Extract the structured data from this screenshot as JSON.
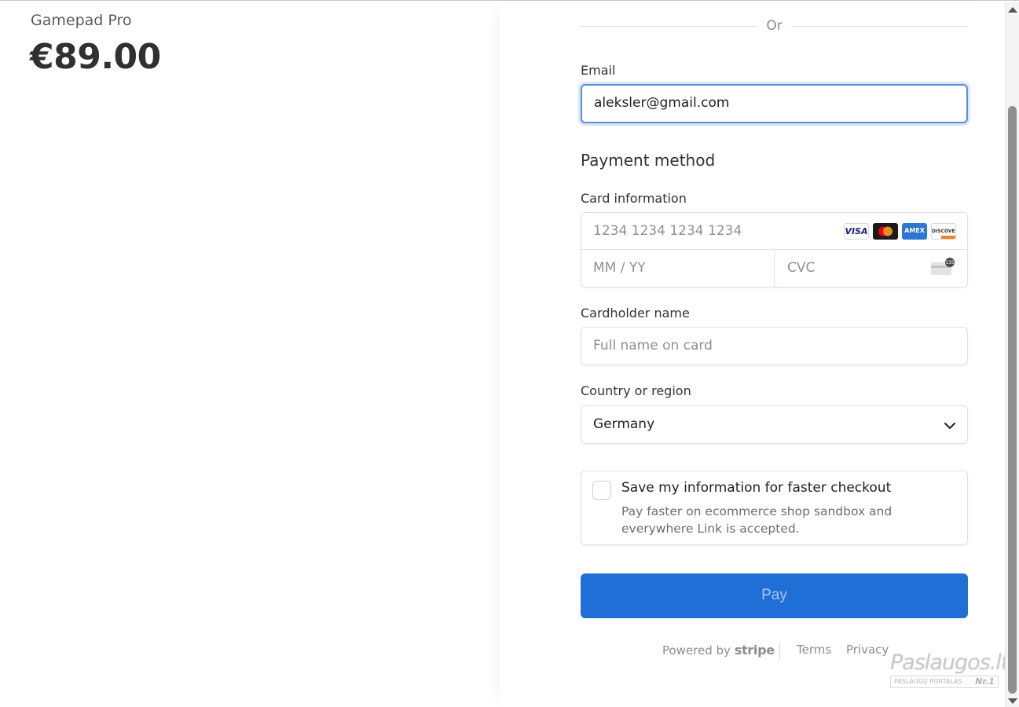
{
  "product": {
    "name": "Gamepad Pro",
    "price": "€89.00"
  },
  "divider": {
    "text": "Or"
  },
  "email": {
    "label": "Email",
    "value": "aleksler@gmail.com"
  },
  "payment": {
    "title": "Payment method",
    "card_label": "Card information",
    "card_number_placeholder": "1234 1234 1234 1234",
    "expiry_placeholder": "MM / YY",
    "cvc_placeholder": "CVC",
    "brands": [
      "VISA",
      "mastercard",
      "AMEX",
      "DISCOVER"
    ],
    "cvc_hint_text": "135"
  },
  "cardholder": {
    "label": "Cardholder name",
    "placeholder": "Full name on card"
  },
  "country": {
    "label": "Country or region",
    "selected": "Germany"
  },
  "save_info": {
    "title": "Save my information for faster checkout",
    "description": "Pay faster on ecommerce shop sandbox and everywhere Link is accepted.",
    "checked": false
  },
  "pay_button": {
    "label": "Pay"
  },
  "footer": {
    "powered_by": "Powered by",
    "stripe": "stripe",
    "terms": "Terms",
    "privacy": "Privacy"
  },
  "watermark": {
    "main": "Paslaugos.lt",
    "sub": "PASLAUGŲ PORTALAS",
    "badge": "Nr.1"
  },
  "colors": {
    "pay_button": "#1f6fd6",
    "focus_border": "#5a8fd8"
  }
}
